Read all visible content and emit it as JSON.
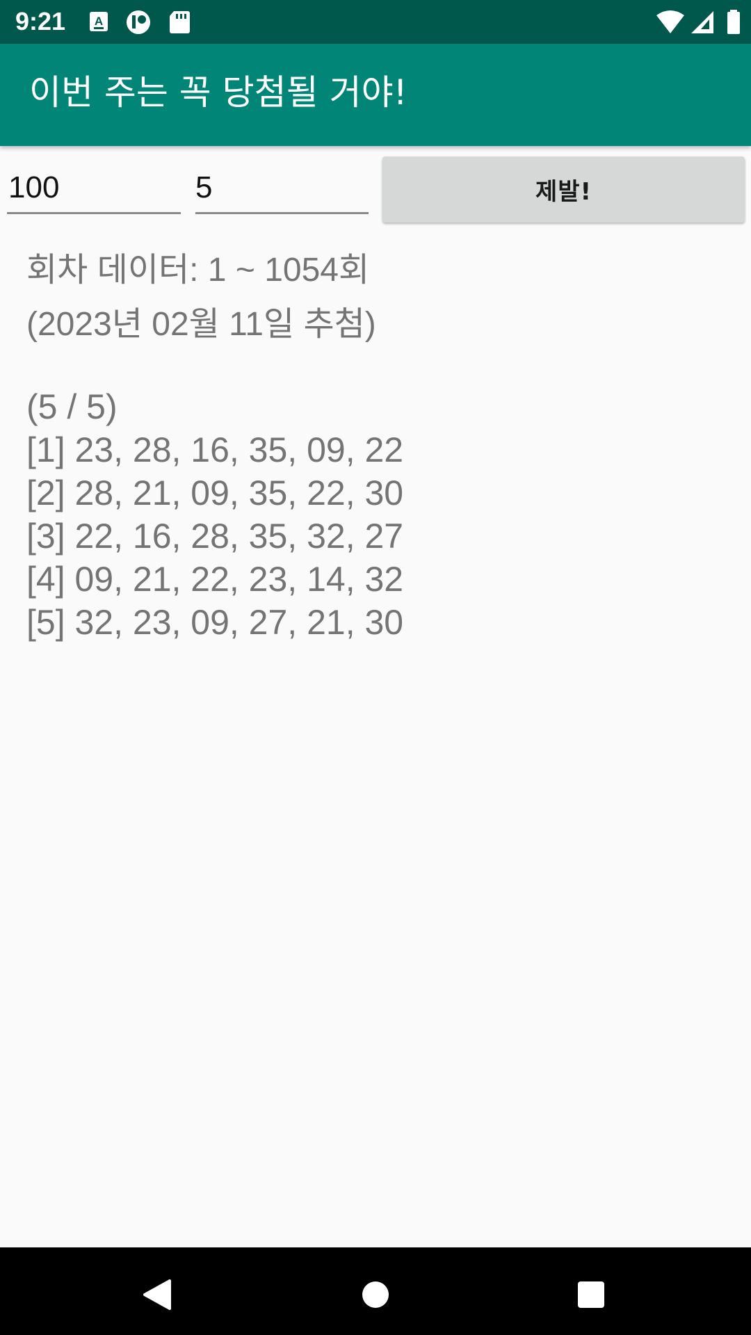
{
  "status_bar": {
    "time": "9:21",
    "left_icons": [
      "keyboard-a-icon",
      "record-icon",
      "sd-card-icon"
    ],
    "right_icons": [
      "wifi-icon",
      "cell-signal-icon",
      "battery-icon"
    ]
  },
  "app_bar": {
    "title": "이번 주는 꼭 당첨될 거야!",
    "color": "#008577",
    "status_color": "#00574b"
  },
  "inputs": {
    "first_value": "100",
    "second_value": "5"
  },
  "button": {
    "label": "제발!"
  },
  "results": {
    "info_line_1": "회차 데이터: 1 ~ 1054회",
    "info_line_2": "(2023년 02월 11일 추첨)",
    "count_line": "(5 / 5)",
    "lines": [
      "[1] 23,  28,  16,  35,  09,  22",
      "[2] 28,  21,  09,  35,  22,  30",
      "[3] 22,  16,  28,  35,  32,  27",
      "[4] 09,  21,  22,  23,  14,  32",
      "[5] 32,  23,  09,  27,  21,  30"
    ]
  },
  "nav_bar": {
    "buttons": [
      "back-icon",
      "home-icon",
      "recents-icon"
    ]
  }
}
